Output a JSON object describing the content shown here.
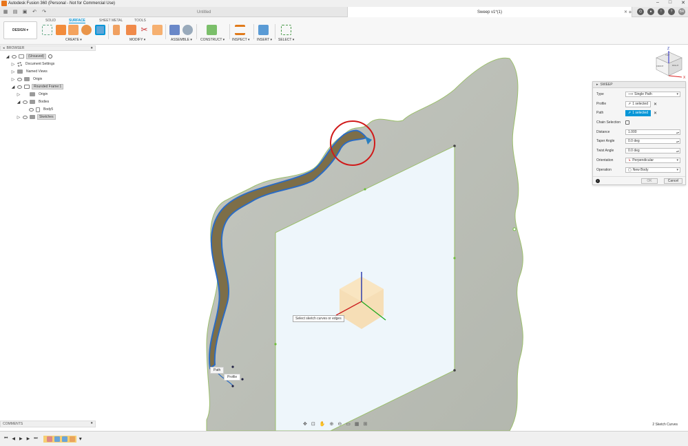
{
  "window": {
    "title": "Autodesk Fusion 360 (Personal - Not for Commercial Use)"
  },
  "tabs": {
    "untitled": "Untitled",
    "active": "Sweep v1*(1)"
  },
  "user_initials": "BR",
  "toolbar": {
    "workspace": "DESIGN",
    "workspace_tabs": [
      "SOLID",
      "SURFACE",
      "SHEET METAL",
      "TOOLS"
    ],
    "groups": [
      "CREATE",
      "MODIFY",
      "ASSEMBLE",
      "CONSTRUCT",
      "INSPECT",
      "INSERT",
      "SELECT"
    ]
  },
  "browser": {
    "title": "BROWSER",
    "items": [
      {
        "label": "(Unsaved)"
      },
      {
        "label": "Document Settings"
      },
      {
        "label": "Named Views"
      },
      {
        "label": "Origin"
      },
      {
        "label": "Rounded Frame:1"
      },
      {
        "label": "Origin"
      },
      {
        "label": "Bodies"
      },
      {
        "label": "Body5"
      },
      {
        "label": "Sketches"
      }
    ]
  },
  "viewcube": {
    "top": "TOP",
    "front": "FRONT",
    "right": "RIGHT",
    "axis_z": "Z",
    "axis_x": "X"
  },
  "viewport": {
    "tooltip": "Select sketch curves or edges",
    "callout_path": "Path",
    "callout_profile": "Profile"
  },
  "sweep": {
    "title": "SWEEP",
    "labels": {
      "type": "Type",
      "profile": "Profile",
      "path": "Path",
      "chain": "Chain Selection",
      "distance": "Distance",
      "taper": "Taper Angle",
      "twist": "Twist Angle",
      "orientation": "Orientation",
      "operation": "Operation"
    },
    "values": {
      "type": "Single Path",
      "profile": "1 selected",
      "path": "1 selected",
      "distance": "1.000",
      "taper": "0.0 deg",
      "twist": "0.0 deg",
      "orientation": "Perpendicular",
      "operation": "New Body"
    },
    "ok": "OK",
    "cancel": "Cancel",
    "colors": {
      "accent": "#0696d7"
    }
  },
  "comments": "COMMENTS",
  "status": "2 Sketch Curves"
}
